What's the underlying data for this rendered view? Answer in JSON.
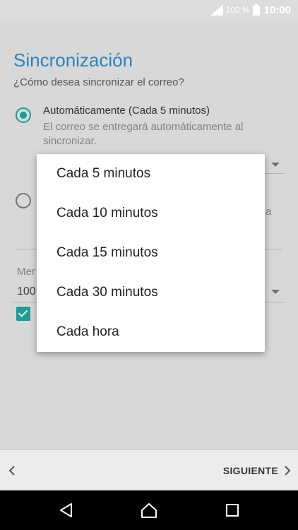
{
  "status_bar": {
    "battery_pct": "100 %",
    "time": "10:00"
  },
  "page": {
    "title": "Sincronización",
    "subtitle": "¿Cómo desea sincronizar el correo?"
  },
  "option_auto": {
    "title": "Automáticamente (Cada 5 minutos)",
    "description": "El correo se entregará automáticamente al sincronizar."
  },
  "partial_text": {
    "option2_fragment": "a",
    "mem_label_fragment": "Mer",
    "mem_value_fragment": "100"
  },
  "dropdown": {
    "options": [
      "Cada 5 minutos",
      "Cada 10 minutos",
      "Cada 15 minutos",
      "Cada 30 minutos",
      "Cada hora"
    ]
  },
  "bottom": {
    "next_label": "SIGUIENTE"
  },
  "colors": {
    "accent": "#1aa7a1",
    "title": "#2d8ccd"
  }
}
